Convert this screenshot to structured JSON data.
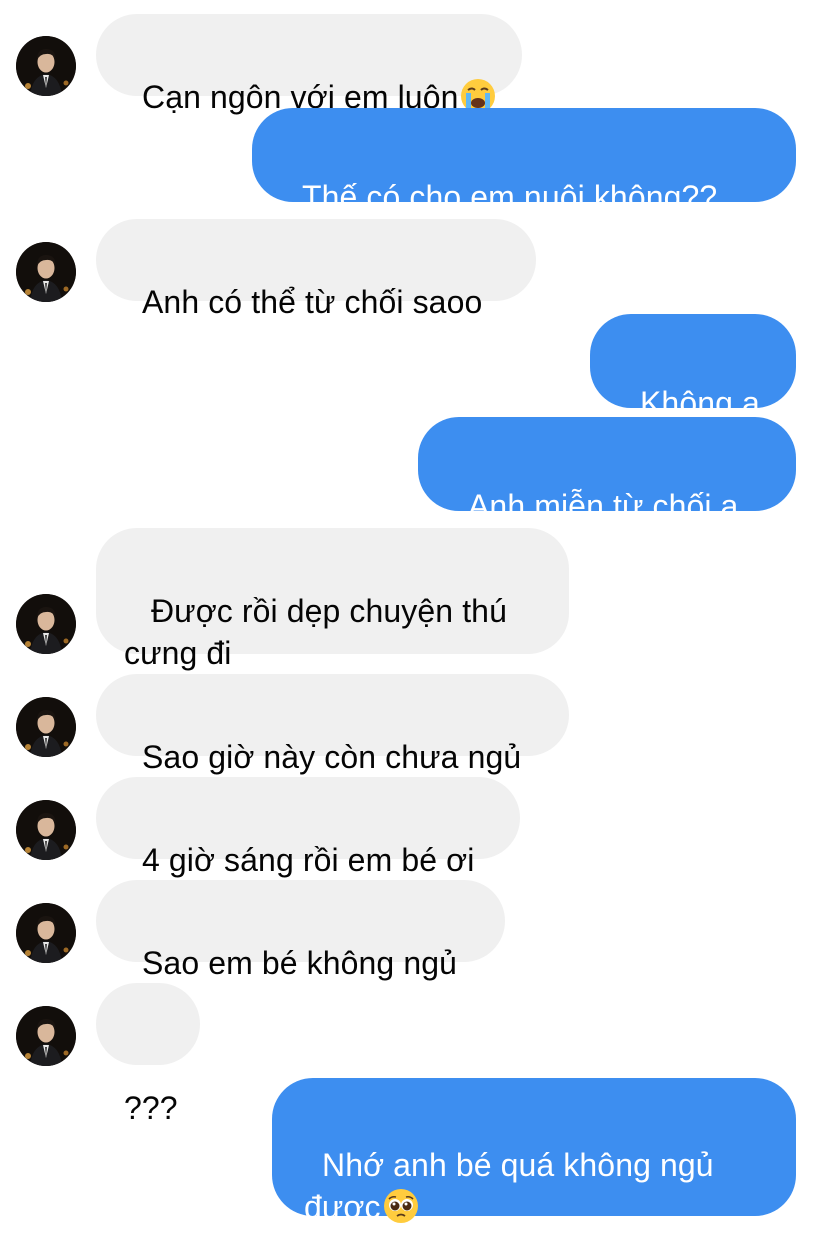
{
  "conversation": {
    "messages": [
      {
        "sender": "contact",
        "text": "Cạn ngôn với em luôn",
        "emoji": "crying-face"
      },
      {
        "sender": "me",
        "text": "Thế có cho em nuôi không??"
      },
      {
        "sender": "contact",
        "text": "Anh có thể từ chối saoo"
      },
      {
        "sender": "me",
        "text": "Không ạ"
      },
      {
        "sender": "me",
        "text": "Anh miễn từ chối ạ"
      },
      {
        "sender": "contact",
        "text": " Được rồi dẹp chuyện thú\ncưng đi"
      },
      {
        "sender": "contact",
        "text": "Sao giờ này còn chưa ngủ"
      },
      {
        "sender": "contact",
        "text": "4 giờ sáng rồi em bé ơi"
      },
      {
        "sender": "contact",
        "text": "Sao em bé không ngủ"
      },
      {
        "sender": "contact",
        "text": "???"
      },
      {
        "sender": "me",
        "text": "Nhớ anh bé quá không ngủ\nđược",
        "emoji": "pleading-face"
      }
    ]
  },
  "colors": {
    "outgoing_bubble": "#3d8ef0",
    "incoming_bubble": "#f0f0f0",
    "incoming_text": "#050505",
    "outgoing_text": "#ffffff"
  },
  "icons": {
    "avatar": "contact-avatar-photo",
    "crying": "loudly-crying-face-emoji",
    "pleading": "pleading-face-emoji"
  }
}
